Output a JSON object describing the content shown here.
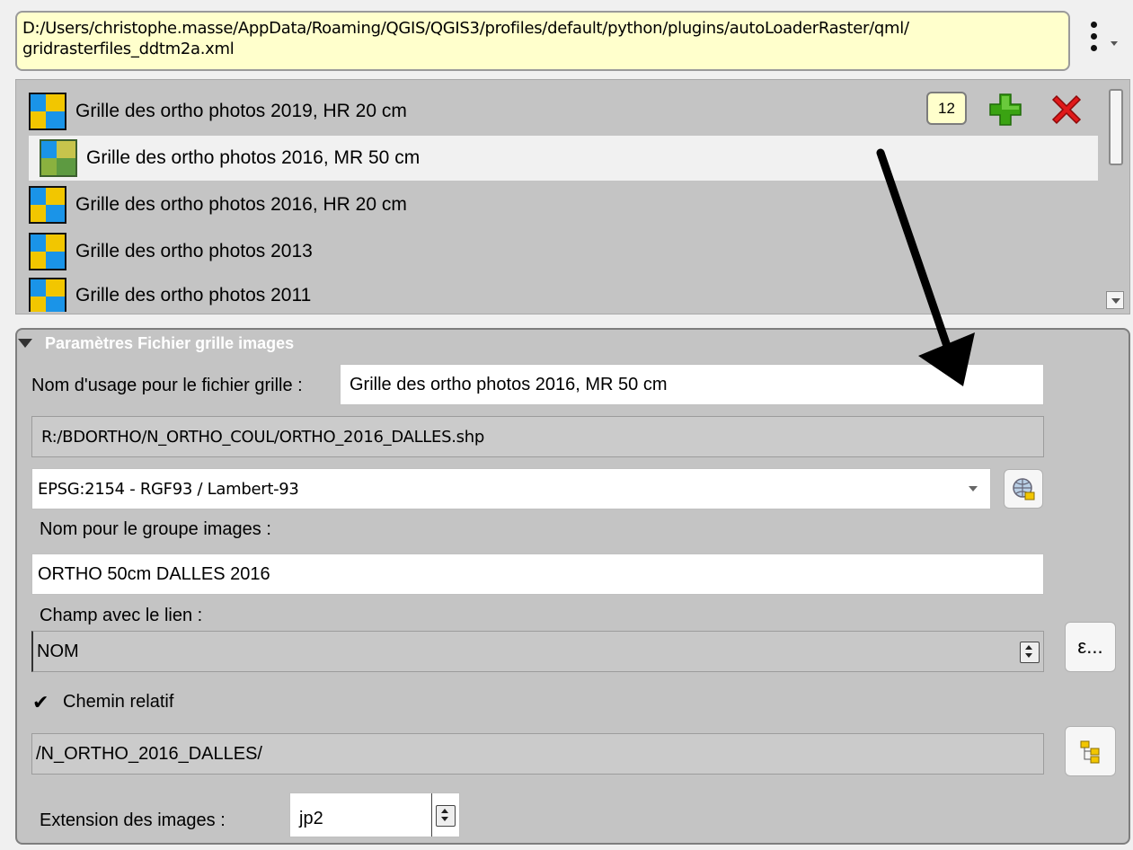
{
  "path_bar": {
    "value": "D:/Users/christophe.masse/AppData/Roaming/QGIS/QGIS3/profiles/default/python/plugins/autoLoaderRaster/qml/\ngridrasterfiles_ddtm2a.xml"
  },
  "list": {
    "count": "12",
    "items": [
      {
        "label": "Grille des ortho photos 2019, HR 20 cm",
        "icon": "raster-grid-icon"
      },
      {
        "label": "Grille des ortho photos 2016, MR 50 cm",
        "icon": "raster-grid-mr-icon",
        "selected": true
      },
      {
        "label": "Grille des ortho photos 2016, HR 20 cm",
        "icon": "raster-grid-icon"
      },
      {
        "label": "Grille des ortho photos 2013",
        "icon": "raster-grid-icon"
      },
      {
        "label": "Grille des ortho photos 2011",
        "icon": "raster-grid-icon"
      }
    ]
  },
  "params": {
    "title": "Paramètres Fichier grille images",
    "usage_name_label": "Nom d'usage pour le fichier grille :",
    "usage_name_value": "Grille des ortho photos 2016, MR 50 cm",
    "shp_path": "R:/BDORTHO/N_ORTHO_COUL/ORTHO_2016_DALLES.shp",
    "crs_value": "EPSG:2154 - RGF93 / Lambert-93",
    "group_name_label": "Nom pour le groupe images :",
    "group_name_value": "ORTHO 50cm DALLES 2016",
    "link_field_label": "Champ avec le lien :",
    "link_field_value": "NOM",
    "expression_button": "ε...",
    "relative_path_label": "Chemin relatif",
    "relative_path_checked": true,
    "relative_path_value": "/N_ORTHO_2016_DALLES/",
    "extension_label": "Extension des images :",
    "extension_value": "jp2"
  },
  "colors": {
    "path_bg": "#ffffcc",
    "panel_bg": "#c4c4c4",
    "add_icon": "#3aa312",
    "delete_icon": "#e0191a"
  }
}
